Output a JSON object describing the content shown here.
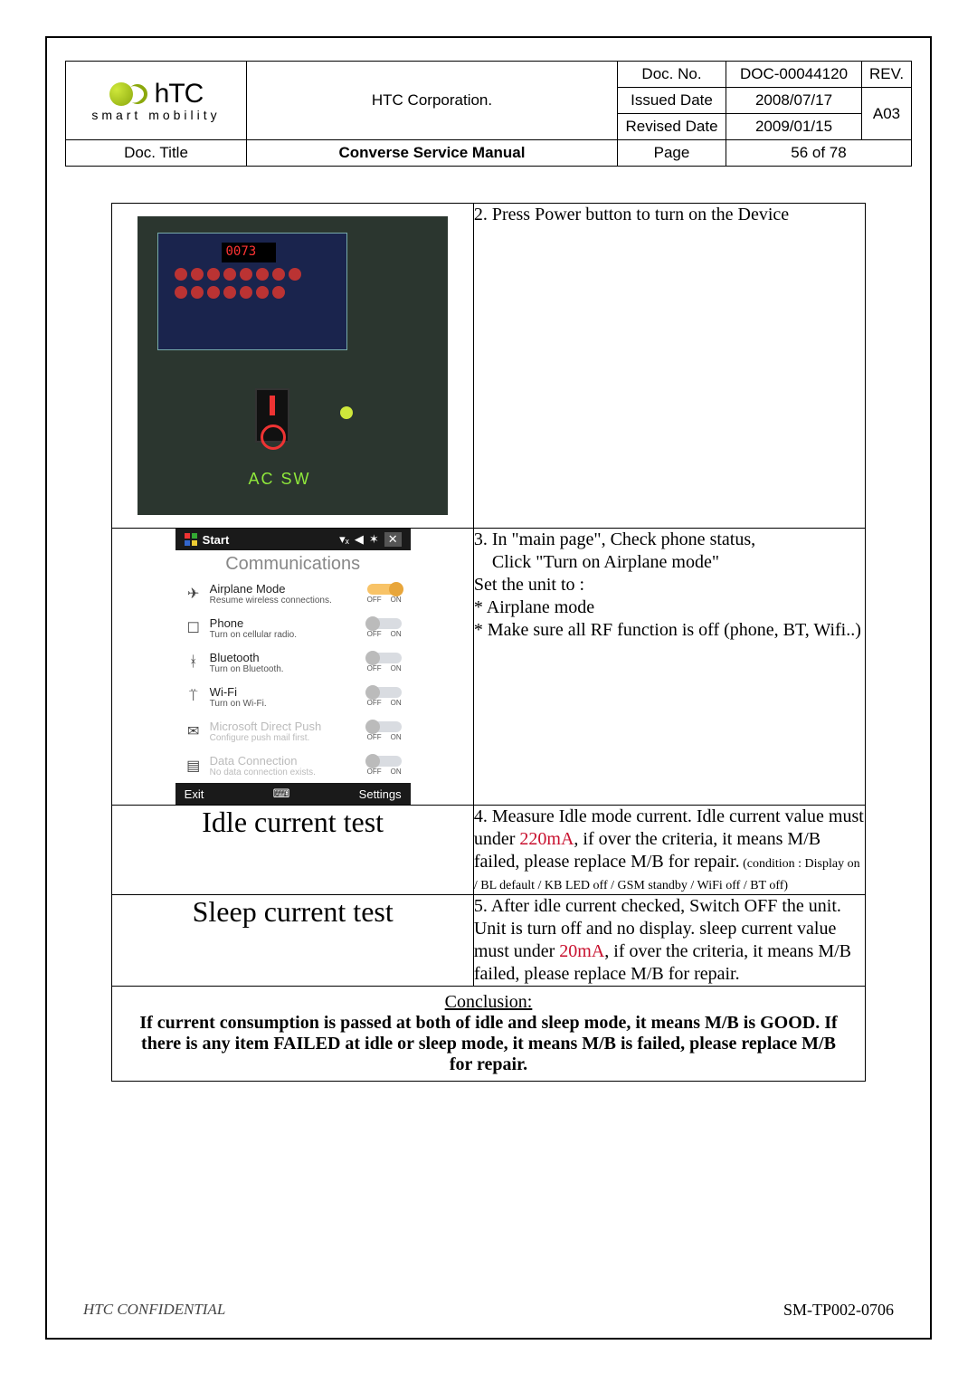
{
  "header": {
    "corporation": "HTC Corporation.",
    "smart_mobility": "smart mobility",
    "doc_no_label": "Doc. No.",
    "doc_no": "DOC-00044120",
    "rev_label": "REV.",
    "rev": "A03",
    "issued_label": "Issued Date",
    "issued": "2008/07/17",
    "revised_label": "Revised Date",
    "revised": "2009/01/15",
    "doc_title_label": "Doc. Title",
    "doc_title": "Converse Service Manual",
    "page_label": "Page",
    "page": "56  of  78",
    "htc_logo_text": "hTC"
  },
  "steps": {
    "s2": "2. Press Power button to turn on the Device",
    "s3_a": "3. In \"main page\", Check phone status,",
    "s3_b": "Click \"Turn on Airplane mode\"",
    "s3_c": "Set the unit to :",
    "s3_d": "* Airplane mode",
    "s3_e": "* Make sure all RF function is off (phone, BT, Wifi..)",
    "s4_a": "4. Measure Idle mode current. Idle current value must under ",
    "s4_red": "220mA",
    "s4_b": ", if over the criteria, it means M/B failed, please replace M/B for repair.",
    "s4_cond": " (condition : Display on / BL default / KB LED off / GSM standby / WiFi off / BT off)",
    "s5_a": "5. After idle current checked, Switch OFF the unit. Unit is turn off and no display. sleep current value must under ",
    "s5_red": "20mA",
    "s5_b": ", if over the criteria, it means M/B failed, please replace M/B for repair."
  },
  "labels": {
    "idle": "Idle current test",
    "sleep": "Sleep current test",
    "conclusion_label": "Conclusion:",
    "conclusion_body": "If current consumption is passed at both of idle and sleep mode, it means M/B is GOOD. If there is any item FAILED at idle or sleep mode, it means M/B is failed, please replace M/B for repair."
  },
  "photo1": {
    "display": "0073",
    "ac_sw": "AC SW"
  },
  "phone": {
    "start": "Start",
    "title": "Communications",
    "exit": "Exit",
    "settings": "Settings",
    "off": "OFF",
    "on": "ON",
    "rows": [
      {
        "name": "Airplane Mode",
        "sub": "Resume wireless connections.",
        "state": "on"
      },
      {
        "name": "Phone",
        "sub": "Turn on cellular radio.",
        "state": "off"
      },
      {
        "name": "Bluetooth",
        "sub": "Turn on Bluetooth.",
        "state": "off"
      },
      {
        "name": "Wi-Fi",
        "sub": "Turn on Wi-Fi.",
        "state": "off"
      },
      {
        "name": "Microsoft Direct Push",
        "sub": "Configure push mail first.",
        "state": "dim"
      },
      {
        "name": "Data Connection",
        "sub": "No data connection exists.",
        "state": "dim"
      }
    ]
  },
  "footer": {
    "confidential": "HTC CONFIDENTIAL",
    "code": "SM-TP002-0706"
  }
}
